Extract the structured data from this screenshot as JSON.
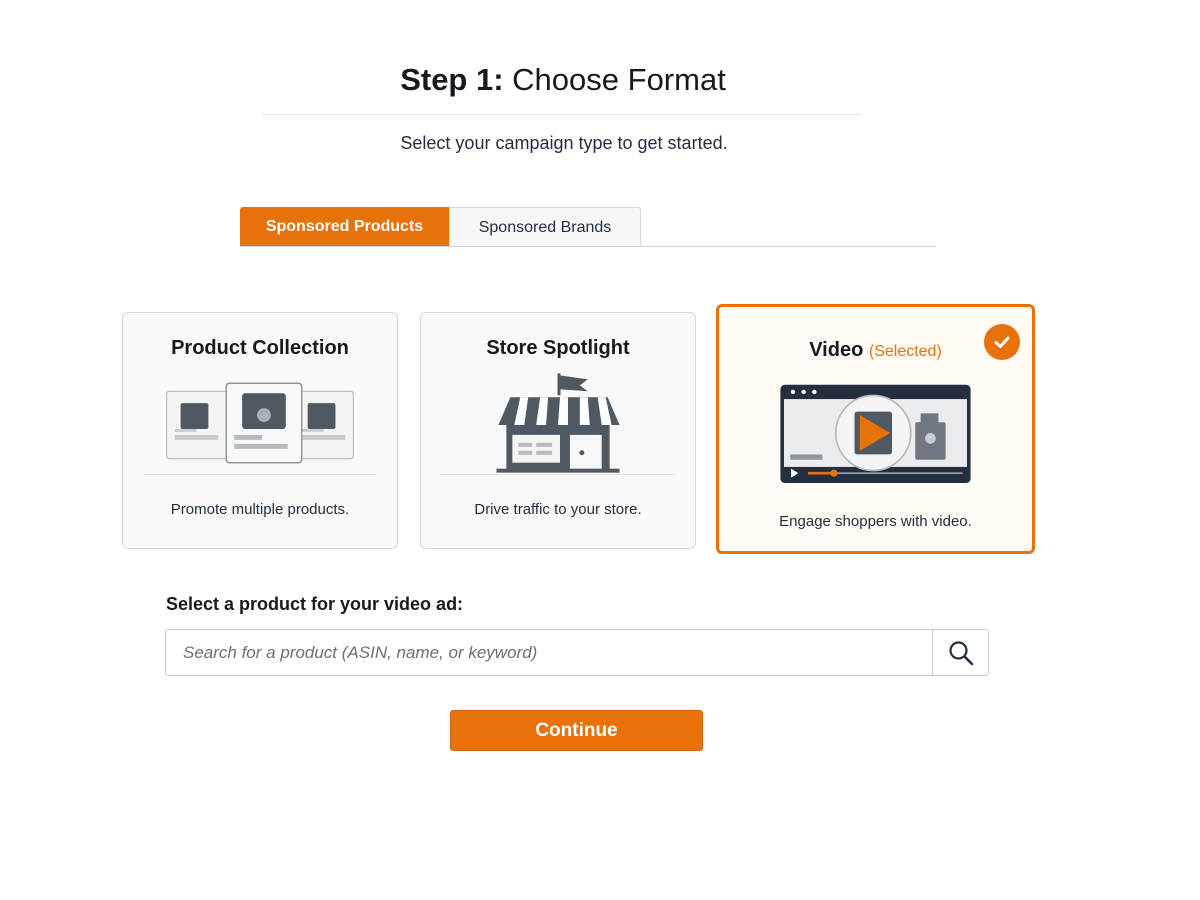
{
  "header": {
    "step": "Step 1:",
    "title": "Choose Format",
    "subtitle": "Select your campaign type to get started."
  },
  "tabs": [
    {
      "label": "Sponsored Products",
      "active": true
    },
    {
      "label": "Sponsored Brands",
      "active": false
    }
  ],
  "cards": {
    "product_collection": {
      "title": "Product Collection",
      "description": "Promote multiple products.",
      "icon": "product-collection-icon"
    },
    "store_spotlight": {
      "title": "Store Spotlight",
      "description": "Drive traffic to your store.",
      "icon": "storefront-icon"
    },
    "video": {
      "title": "Video",
      "selected_label": "(Selected)",
      "description": "Engage shoppers with video.",
      "icon": "video-player-icon",
      "selected": true
    }
  },
  "product_search": {
    "label": "Select a product for your video ad:",
    "placeholder": "Search for a product (ASIN, name, or keyword)",
    "value": "",
    "button_icon": "search-icon"
  },
  "actions": {
    "continue_label": "Continue"
  },
  "colors": {
    "accent": "#e8710a",
    "text": "#16191f",
    "icon_gray": "#4f5961"
  }
}
